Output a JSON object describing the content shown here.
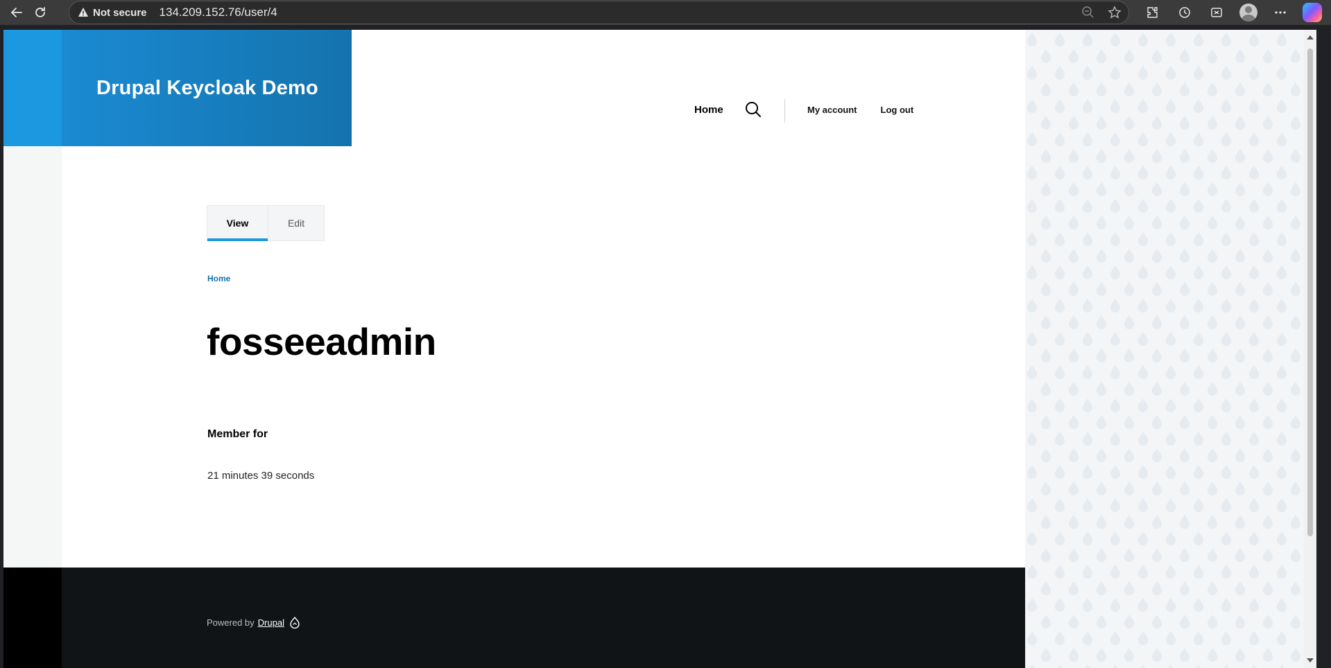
{
  "browser": {
    "security_label": "Not secure",
    "url": "134.209.152.76/user/4"
  },
  "site": {
    "name": "Drupal Keycloak Demo"
  },
  "main_nav": {
    "home": "Home"
  },
  "account_nav": {
    "my_account": "My account",
    "log_out": "Log out"
  },
  "tabs": [
    {
      "label": "View",
      "active": true
    },
    {
      "label": "Edit",
      "active": false
    }
  ],
  "breadcrumb": {
    "home": "Home"
  },
  "user": {
    "name": "fosseeadmin",
    "member_for_label": "Member for",
    "member_for_value": "21 minutes 39 seconds"
  },
  "footer": {
    "powered_by": "Powered by",
    "drupal_link": "Drupal"
  },
  "colors": {
    "brand_blue": "#1b8ad2",
    "link_blue": "#1470aa",
    "footer_bg": "#111417"
  }
}
